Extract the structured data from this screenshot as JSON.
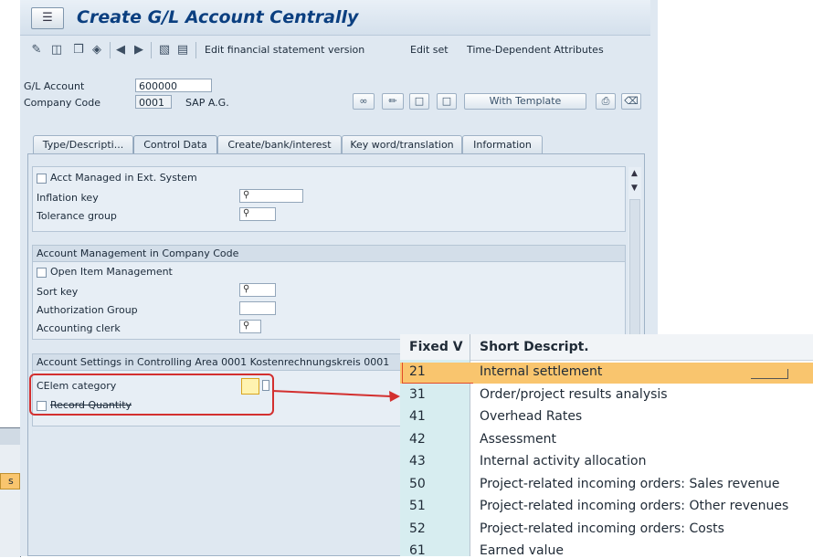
{
  "window": {
    "title": "Create G/L Account Centrally"
  },
  "toolbar": {
    "icons": [
      "display-change-icon",
      "other-object-icon",
      "copy-icon",
      "compare-icon",
      "previous-icon",
      "next-icon",
      "tree-icon",
      "document-icon"
    ],
    "buttons": [
      "Edit financial statement version",
      "Edit set",
      "Time-Dependent Attributes"
    ]
  },
  "header": {
    "gl_account_label": "G/L Account",
    "gl_account_value": "600000",
    "company_code_label": "Company Code",
    "company_code_value": "0001",
    "company_name": "SAP A.G.",
    "with_template_label": "With Template"
  },
  "tabs": [
    {
      "label": "Type/Descripti..."
    },
    {
      "label": "Control Data",
      "active": true
    },
    {
      "label": "Create/bank/interest"
    },
    {
      "label": "Key word/translation"
    },
    {
      "label": "Information"
    }
  ],
  "control_data": {
    "acct_managed_label": "Acct Managed in Ext. System",
    "inflation_key_label": "Inflation key",
    "tolerance_group_label": "Tolerance group",
    "acct_mgmt_header": "Account Management in Company Code",
    "open_item_label": "Open Item Management",
    "sort_key_label": "Sort key",
    "auth_group_label": "Authorization Group",
    "accounting_clerk_label": "Accounting clerk",
    "acct_settings_header": "Account Settings in Controlling Area 0001 Kostenrechnungskreis 0001",
    "celem_category_label": "CElem category",
    "record_quantity_label": "Record Quantity"
  },
  "popup": {
    "col_fixed": "Fixed V",
    "col_desc": "Short Descript.",
    "rows": [
      {
        "code": "21",
        "desc": "Internal settlement"
      },
      {
        "code": "31",
        "desc": "Order/project results analysis"
      },
      {
        "code": "41",
        "desc": "Overhead Rates"
      },
      {
        "code": "42",
        "desc": "Assessment"
      },
      {
        "code": "43",
        "desc": "Internal activity allocation"
      },
      {
        "code": "50",
        "desc": "Project-related incoming orders: Sales revenue"
      },
      {
        "code": "51",
        "desc": "Project-related incoming orders: Other revenues"
      },
      {
        "code": "52",
        "desc": "Project-related incoming orders: Costs"
      },
      {
        "code": "61",
        "desc": "Earned value"
      }
    ]
  },
  "left_fragment": {
    "text": "s"
  },
  "colors": {
    "highlight": "#f9c56e",
    "annotation": "#d32f2f",
    "title": "#0b3f80"
  }
}
